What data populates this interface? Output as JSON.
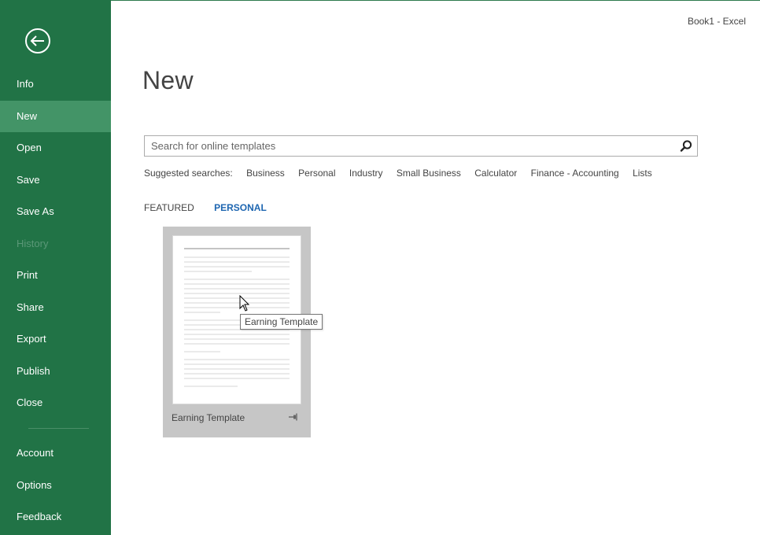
{
  "window": {
    "title": "Book1 - Excel"
  },
  "sidebar": {
    "items": [
      {
        "label": "Info"
      },
      {
        "label": "New"
      },
      {
        "label": "Open"
      },
      {
        "label": "Save"
      },
      {
        "label": "Save As"
      },
      {
        "label": "History"
      },
      {
        "label": "Print"
      },
      {
        "label": "Share"
      },
      {
        "label": "Export"
      },
      {
        "label": "Publish"
      },
      {
        "label": "Close"
      }
    ],
    "bottom_items": [
      {
        "label": "Account"
      },
      {
        "label": "Options"
      },
      {
        "label": "Feedback"
      }
    ],
    "active": "New",
    "disabled": "History"
  },
  "main": {
    "title": "New",
    "search": {
      "placeholder": "Search for online templates",
      "value": ""
    },
    "suggested": {
      "label": "Suggested searches:",
      "items": [
        "Business",
        "Personal",
        "Industry",
        "Small Business",
        "Calculator",
        "Finance - Accounting",
        "Lists"
      ]
    },
    "tabs": [
      {
        "label": "FEATURED",
        "active": false
      },
      {
        "label": "PERSONAL",
        "active": true
      }
    ],
    "templates": [
      {
        "name": "Earning Template"
      }
    ],
    "tooltip": "Earning Template"
  },
  "icons": {
    "back": "back-arrow-icon",
    "search": "search-icon",
    "pin": "pin-icon"
  },
  "colors": {
    "sidebar_bg": "#217346",
    "sidebar_active": "#439467",
    "accent_tab": "#1e66b1"
  }
}
